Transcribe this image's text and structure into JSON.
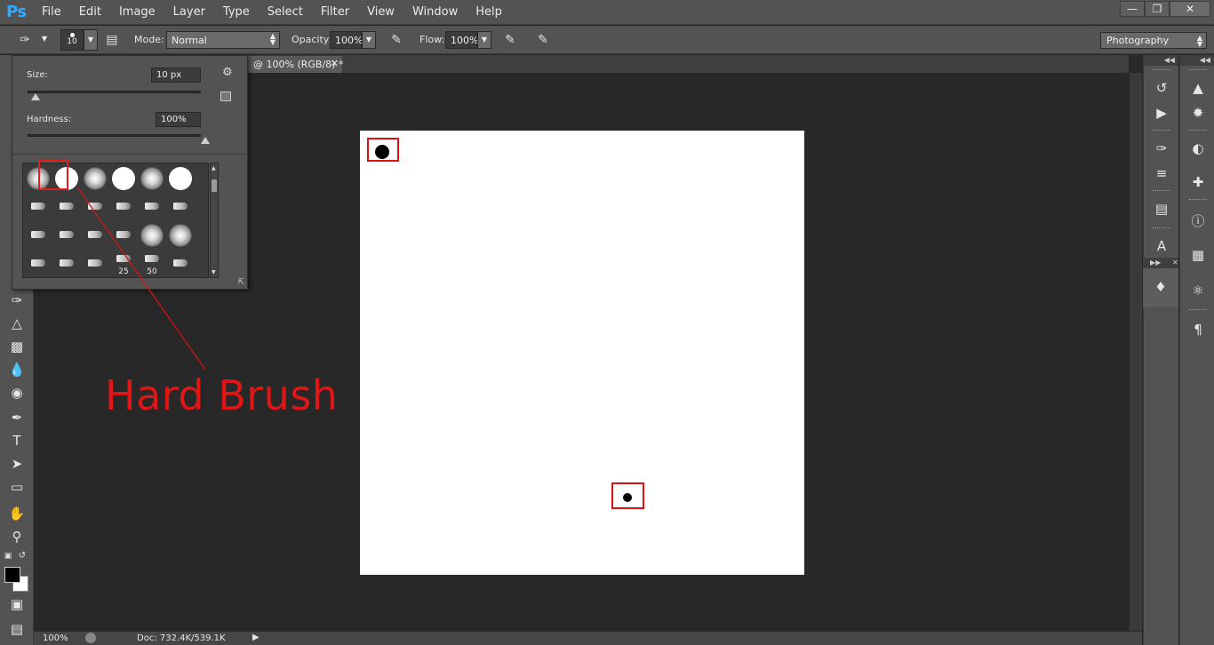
{
  "app": {
    "logo": "Ps"
  },
  "menubar": {
    "items": [
      "File",
      "Edit",
      "Image",
      "Layer",
      "Type",
      "Select",
      "Filter",
      "View",
      "Window",
      "Help"
    ]
  },
  "options": {
    "brush_size": "10",
    "mode_label": "Mode:",
    "mode_value": "Normal",
    "opacity_label": "Opacity:",
    "opacity_value": "100%",
    "flow_label": "Flow:",
    "flow_value": "100%",
    "workspace": "Photography"
  },
  "document": {
    "tab_title": "@ 100% (RGB/8) *"
  },
  "brush_picker": {
    "size_label": "Size:",
    "size_value": "10 px",
    "size_fraction": 0.02,
    "hardness_label": "Hardness:",
    "hardness_value": "100%",
    "hardness_fraction": 1.0,
    "brushes": [
      {
        "type": "soft"
      },
      {
        "type": "hard",
        "selected": true
      },
      {
        "type": "soft"
      },
      {
        "type": "hard"
      },
      {
        "type": "soft"
      },
      {
        "type": "hard"
      },
      {
        "type": "shape"
      },
      {
        "type": "shape"
      },
      {
        "type": "shape"
      },
      {
        "type": "shape"
      },
      {
        "type": "shape"
      },
      {
        "type": "shape"
      },
      {
        "type": "shape"
      },
      {
        "type": "shape"
      },
      {
        "type": "shape"
      },
      {
        "type": "shape"
      },
      {
        "type": "soft"
      },
      {
        "type": "soft"
      },
      {
        "type": "shape"
      },
      {
        "type": "shape"
      },
      {
        "type": "shape"
      },
      {
        "type": "shape",
        "size": "25"
      },
      {
        "type": "shape",
        "size": "50"
      },
      {
        "type": "shape"
      }
    ]
  },
  "annotation": {
    "text": "Hard Brush"
  },
  "status": {
    "zoom": "100%",
    "doc_info": "Doc: 732.4K/539.1K"
  },
  "colors": {
    "accent_logo": "#31a8ff",
    "annotation_red": "#e01515",
    "foreground": "#000000",
    "background": "#ffffff"
  }
}
